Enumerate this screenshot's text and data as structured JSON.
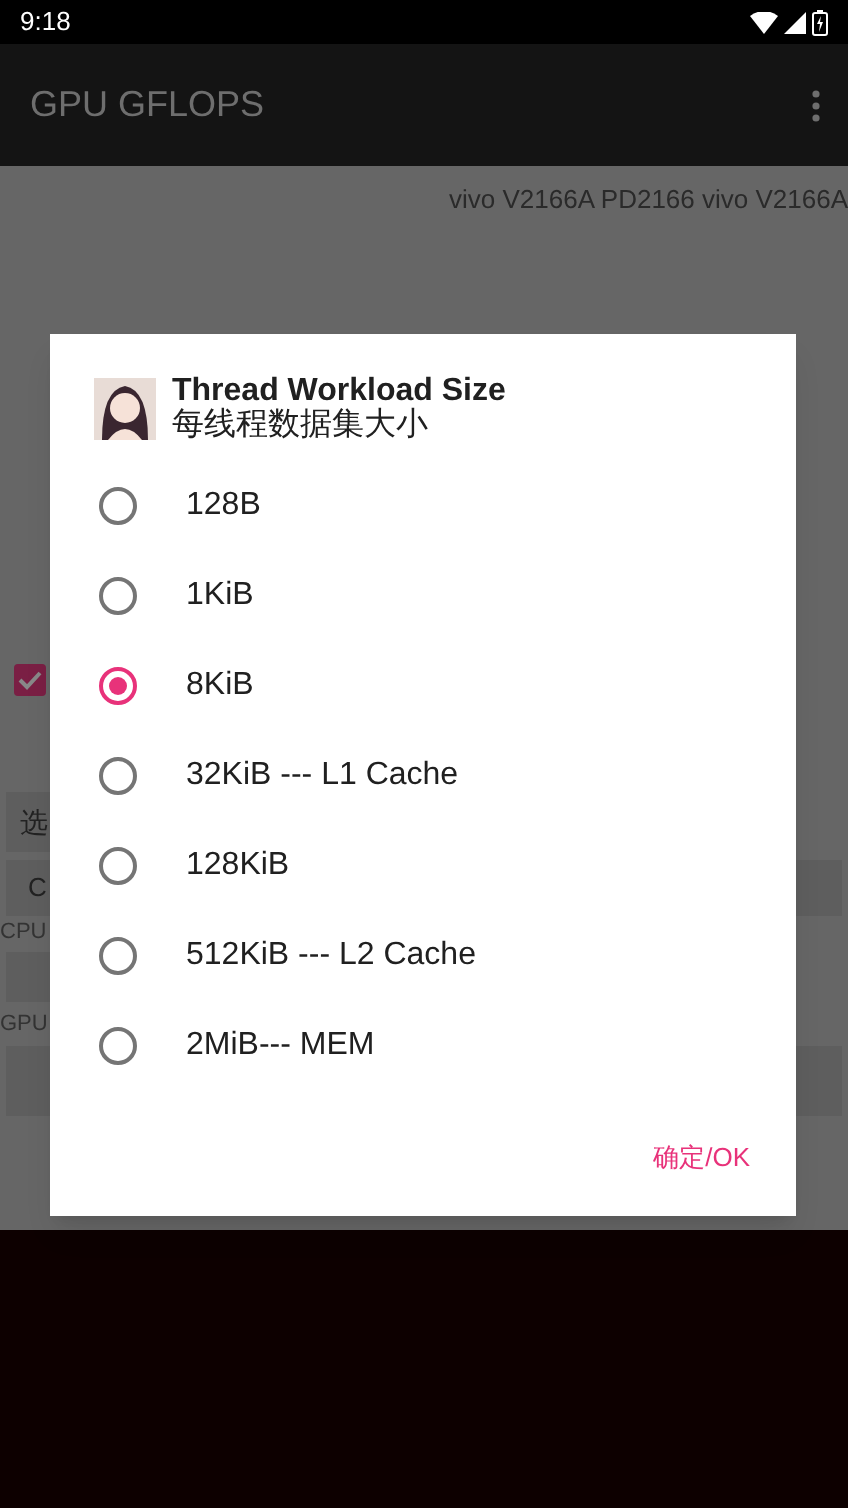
{
  "status_bar": {
    "time": "9:18"
  },
  "app_bar": {
    "title": "GPU GFLOPS"
  },
  "background": {
    "device_text": "vivo V2166A PD2166 vivo V2166A",
    "checkbox": {
      "checked": true
    },
    "select_label": "选",
    "button_label": "C",
    "cpu_label": "CPU",
    "gpu_label": "GPU"
  },
  "dialog": {
    "title": "Thread Workload Size",
    "subtitle": "每线程数据集大小",
    "options": [
      {
        "label": "128B",
        "selected": false
      },
      {
        "label": "1KiB",
        "selected": false
      },
      {
        "label": "8KiB",
        "selected": true
      },
      {
        "label": "32KiB --- L1 Cache",
        "selected": false
      },
      {
        "label": "128KiB",
        "selected": false
      },
      {
        "label": "512KiB --- L2 Cache",
        "selected": false
      },
      {
        "label": "2MiB--- MEM",
        "selected": false
      }
    ],
    "ok_button": "确定/OK"
  }
}
